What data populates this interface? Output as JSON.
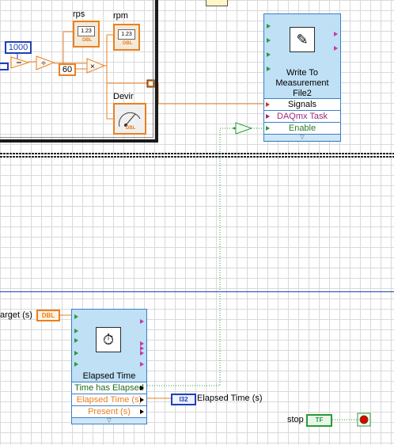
{
  "top_loop": {
    "const_1000": "1000",
    "const_60": "60",
    "rps_label": "rps",
    "rpm_label": "rpm",
    "devir_label": "Devir",
    "indicator_text": "1.23",
    "dbl_tag": "DBL"
  },
  "write_vi": {
    "title": "Write To Measurement File2",
    "signals": "Signals",
    "daqmx_task": "DAQmx Task",
    "enable": "Enable"
  },
  "elapsed_vi": {
    "title": "Elapsed Time",
    "time_has_elapsed": "Time has Elapsed",
    "elapsed_time_s": "Elapsed Time (s)",
    "present_s": "Present (s)"
  },
  "target_label": "arget (s)",
  "dbl_tag": "DBL",
  "elapsed_indicator": {
    "tag": "I32",
    "label": "Elapsed Time (s)"
  },
  "stop": {
    "label": "stop",
    "tag": "TF"
  },
  "colors": {
    "numeric_double": "#e98020",
    "numeric_int": "#1f3fb8",
    "boolean": "#2a9a3a",
    "express_vi": "#bfe0f5"
  }
}
